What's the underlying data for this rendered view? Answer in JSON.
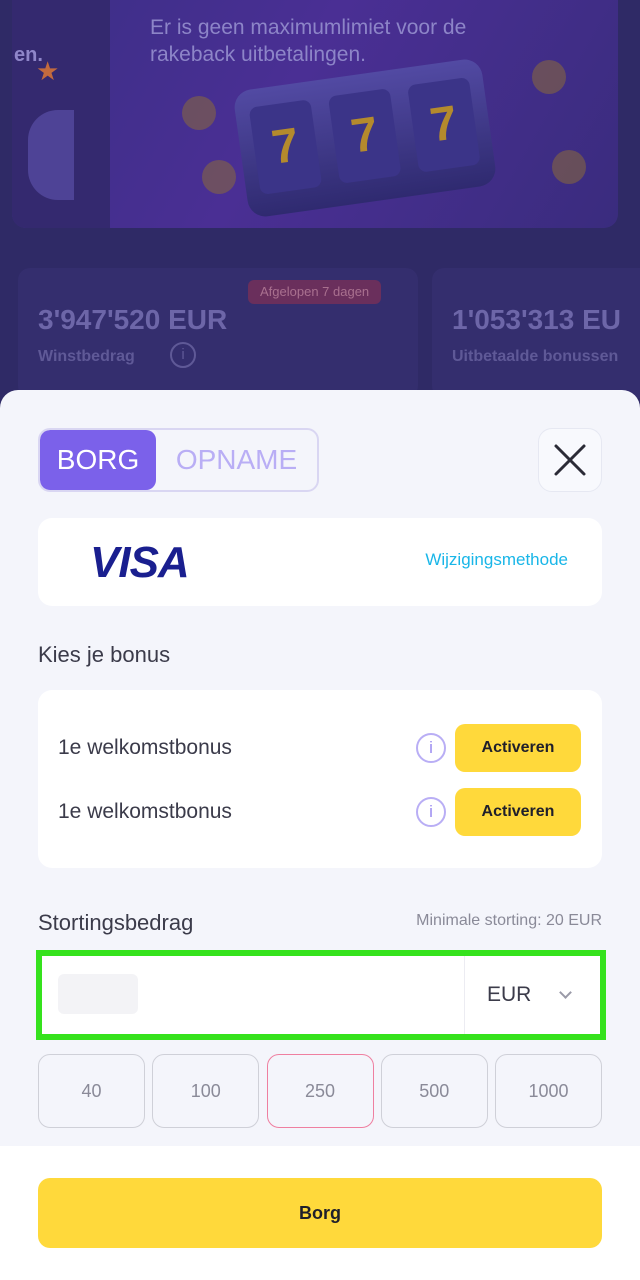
{
  "background": {
    "banner_fragment": "en.",
    "banner_text": "Er is geen maximumlimiet voor de rakeback uitbetalingen.",
    "slot_reels": [
      "7",
      "7",
      "7"
    ],
    "period_badge": "Afgelopen 7 dagen",
    "stats": [
      {
        "value": "3'947'520 EUR",
        "label": "Winstbedrag"
      },
      {
        "value": "1'053'313 EU",
        "label": "Uitbetaalde bonussen"
      }
    ]
  },
  "modal": {
    "tabs": [
      {
        "label": "BORG",
        "active": true
      },
      {
        "label": "OPNAME",
        "active": false
      }
    ],
    "payment_method": {
      "brand": "VISA",
      "change_label": "Wijzigingsmethode"
    },
    "bonus_section": {
      "title": "Kies je bonus",
      "items": [
        {
          "label": "1e welkomstbonus",
          "button": "Activeren"
        },
        {
          "label": "1e welkomstbonus",
          "button": "Activeren"
        }
      ]
    },
    "deposit": {
      "title": "Stortingsbedrag",
      "min_note": "Minimale storting: 20 EUR",
      "amount_value": "",
      "currency": "EUR",
      "presets": [
        "40",
        "100",
        "250",
        "500",
        "1000"
      ],
      "selected_preset": "250"
    },
    "submit_label": "Borg"
  },
  "colors": {
    "accent": "#7b61ea",
    "button_yellow": "#ffd93b",
    "link": "#19b6e8",
    "highlight": "#35e21d",
    "preset_selected_border": "#ef7fa0"
  }
}
